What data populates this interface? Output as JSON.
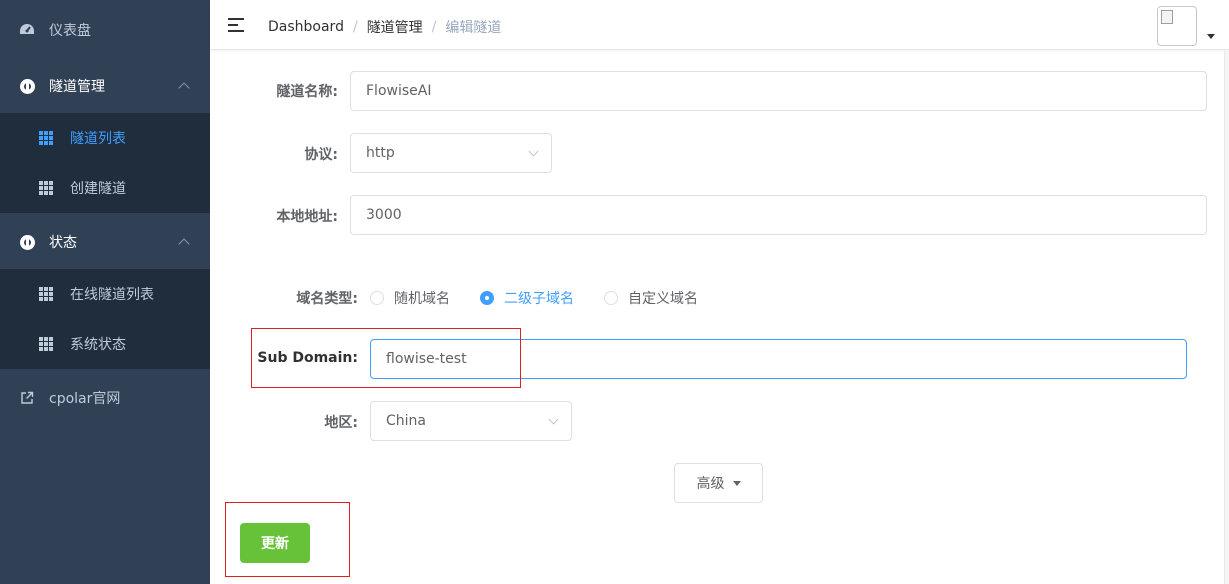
{
  "sidebar": {
    "items": [
      {
        "label": "仪表盘",
        "icon": "dashboard-icon"
      },
      {
        "label": "隧道管理",
        "icon": "circle-icon"
      },
      {
        "label": "隧道列表",
        "icon": "grid-icon",
        "active": true
      },
      {
        "label": "创建隧道",
        "icon": "grid-icon"
      },
      {
        "label": "状态",
        "icon": "circle-icon"
      },
      {
        "label": "在线隧道列表",
        "icon": "grid-icon"
      },
      {
        "label": "系统状态",
        "icon": "grid-icon"
      },
      {
        "label": "cpolar官网",
        "icon": "external-link-icon"
      }
    ]
  },
  "header": {
    "breadcrumb": [
      "Dashboard",
      "隧道管理",
      "编辑隧道"
    ]
  },
  "form": {
    "tunnel_name": {
      "label": "隧道名称:",
      "value": "FlowiseAI"
    },
    "protocol": {
      "label": "协议:",
      "value": "http"
    },
    "local_address": {
      "label": "本地地址:",
      "value": "3000"
    },
    "domain_type": {
      "label": "域名类型:",
      "options": [
        "随机域名",
        "二级子域名",
        "自定义域名"
      ],
      "selected": "二级子域名"
    },
    "sub_domain": {
      "label": "Sub Domain:",
      "value": "flowise-test"
    },
    "region": {
      "label": "地区:",
      "value": "China"
    },
    "advanced_label": "高级",
    "update_label": "更新"
  },
  "colors": {
    "sidebar_bg": "#304156",
    "submenu_bg": "#1f2d3d",
    "active": "#409eff",
    "update_button": "#67c23a",
    "highlight_box": "#e02020"
  }
}
